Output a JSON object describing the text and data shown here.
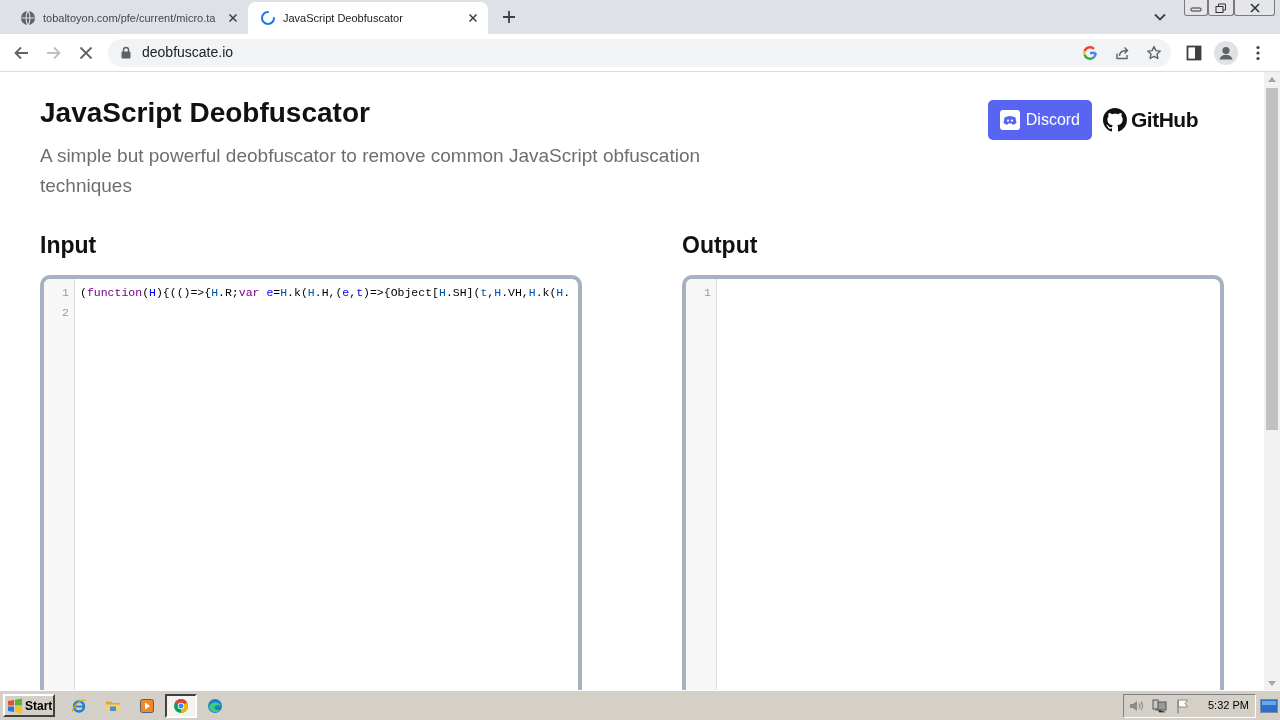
{
  "browser": {
    "tabs": [
      {
        "title": "tobaltoyon.com/pfe/current/micro.ta",
        "selected": false,
        "loading": false
      },
      {
        "title": "JavaScript Deobfuscator",
        "selected": true,
        "loading": true
      }
    ],
    "can_go_back": true,
    "can_go_forward": false,
    "address": "deobfuscate.io"
  },
  "page": {
    "title": "JavaScript Deobfuscator",
    "subtitle": "A simple but powerful deobfuscator to remove common JavaScript obfuscation techniques",
    "links": [
      {
        "kind": "discord",
        "label": "Discord"
      },
      {
        "kind": "github",
        "label": "GitHub"
      }
    ],
    "panels": [
      {
        "heading": "Input",
        "lines": [
          {
            "number": "1",
            "tokens": [
              {
                "text": "(",
                "kind": "plain"
              },
              {
                "text": "function",
                "kind": "keyword"
              },
              {
                "text": "(",
                "kind": "plain"
              },
              {
                "text": "H",
                "kind": "def"
              },
              {
                "text": "){(()=>{",
                "kind": "plain"
              },
              {
                "text": "H",
                "kind": "variable"
              },
              {
                "text": ".R;",
                "kind": "plain"
              },
              {
                "text": "var ",
                "kind": "keyword"
              },
              {
                "text": "e",
                "kind": "def"
              },
              {
                "text": "=",
                "kind": "plain"
              },
              {
                "text": "H",
                "kind": "variable"
              },
              {
                "text": ".k(",
                "kind": "plain"
              },
              {
                "text": "H",
                "kind": "variable"
              },
              {
                "text": ".H,(",
                "kind": "plain"
              },
              {
                "text": "e",
                "kind": "def"
              },
              {
                "text": ",",
                "kind": "plain"
              },
              {
                "text": "t",
                "kind": "def"
              },
              {
                "text": ")=>{Object[",
                "kind": "plain"
              },
              {
                "text": "H",
                "kind": "variable"
              },
              {
                "text": ".SH](",
                "kind": "plain"
              },
              {
                "text": "t",
                "kind": "variable"
              },
              {
                "text": ",",
                "kind": "plain"
              },
              {
                "text": "H",
                "kind": "variable"
              },
              {
                "text": ".VH,",
                "kind": "plain"
              },
              {
                "text": "H",
                "kind": "variable"
              },
              {
                "text": ".k(",
                "kind": "plain"
              },
              {
                "text": "H",
                "kind": "variable"
              },
              {
                "text": ".",
                "kind": "plain"
              }
            ]
          },
          {
            "number": "2"
          }
        ]
      },
      {
        "heading": "Output",
        "lines": [
          {
            "number": "1"
          }
        ]
      }
    ]
  },
  "taskbar": {
    "start": "Start",
    "apps": [
      {
        "kind": "ie",
        "selected": false
      },
      {
        "kind": "explorer",
        "selected": false
      },
      {
        "kind": "media",
        "selected": false
      },
      {
        "kind": "chrome",
        "selected": true
      },
      {
        "kind": "edge",
        "selected": false
      }
    ],
    "clock": "5:32 PM"
  }
}
